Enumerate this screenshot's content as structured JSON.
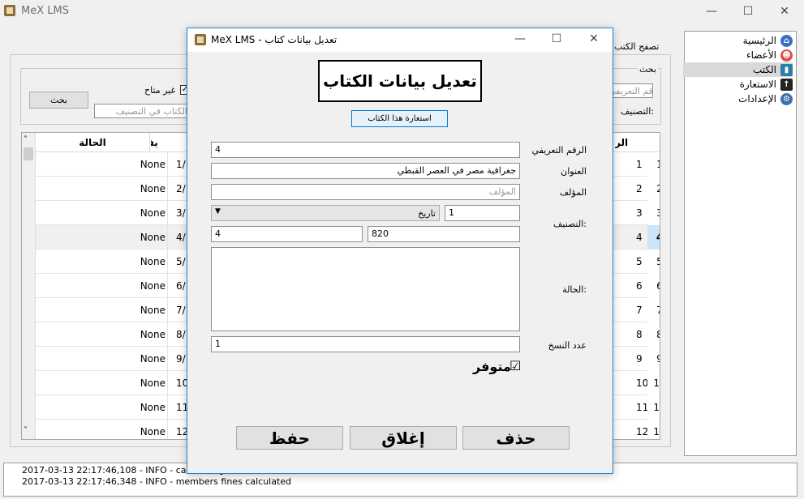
{
  "app": {
    "title": "MeX LMS"
  },
  "sidebar": {
    "items": [
      {
        "label": "الرئيسية",
        "icon": "home-icon",
        "color": "#3b6fc4"
      },
      {
        "label": "الأعضاء",
        "icon": "members-icon",
        "color": "#d9534f"
      },
      {
        "label": "الكتب",
        "icon": "book-icon",
        "color": "#2a7ea8"
      },
      {
        "label": "الاستعارة",
        "icon": "borrow-icon",
        "color": "#222222"
      },
      {
        "label": "الإعدادات",
        "icon": "settings-icon",
        "color": "#3a6fb0"
      }
    ]
  },
  "browse": {
    "tab_label": "تصفح الكتب",
    "search_section": "بحث",
    "id_placeholder": "الرقم التعريفي",
    "not_available_label": "غير متاح",
    "category_label": "التصنيف:",
    "category_placeholder": "الكتاب في التصنيف",
    "search_button": "بحث"
  },
  "table": {
    "headers": [
      "الحالة",
      "التصنيف",
      "الرقم"
    ],
    "rows": [
      {
        "num": "1",
        "id": "1",
        "cls": "1/",
        "status": "None"
      },
      {
        "num": "2",
        "id": "2",
        "cls": "2/",
        "status": "None"
      },
      {
        "num": "3",
        "id": "3",
        "cls": "3/",
        "status": "None"
      },
      {
        "num": "4",
        "id": "4",
        "cls": "4/",
        "status": "None"
      },
      {
        "num": "5",
        "id": "5",
        "cls": "5/",
        "status": "None"
      },
      {
        "num": "6",
        "id": "6",
        "cls": "6/",
        "status": "None"
      },
      {
        "num": "7",
        "id": "7",
        "cls": "7/",
        "status": "None"
      },
      {
        "num": "8",
        "id": "8",
        "cls": "8/",
        "status": "None"
      },
      {
        "num": "9",
        "id": "9",
        "cls": "9/",
        "status": "None"
      },
      {
        "num": "10",
        "id": "10",
        "cls": "10/",
        "status": "None"
      },
      {
        "num": "11",
        "id": "11",
        "cls": "11/",
        "status": "None"
      },
      {
        "num": "12",
        "id": "12",
        "cls": "12/",
        "status": "None"
      }
    ],
    "selected_row": 4
  },
  "log": {
    "lines": [
      "2017-03-13 22:17:46,108 - INFO - calculating members fines ....",
      "2017-03-13 22:17:46,348 - INFO - members fines calculated"
    ]
  },
  "dialog": {
    "title": "MeX LMS - تعديل بيانات كتاب",
    "heading": "تعديل بيانات الكتاب",
    "borrow_button": "استعارة هذا الكتاب",
    "id_label": "الرقم التعريفي",
    "id_value": "4",
    "title_label": "العنوان",
    "title_value": "جغرافية مصر في العصر القبطي",
    "author_label": "المؤلف",
    "author_placeholder": "المؤلف",
    "category_label": "التصنيف:",
    "category_select": "تاريخ",
    "category_num": "1",
    "class_num": "820",
    "class_suffix": "4",
    "status_label": "الحالة:",
    "status_value": "",
    "copies_label": "عدد النسخ",
    "copies_value": "1",
    "available_label": "متوفر",
    "available_checked": "☑",
    "delete_button": "حذف",
    "close_button": "إغلاق",
    "save_button": "حفظ"
  }
}
